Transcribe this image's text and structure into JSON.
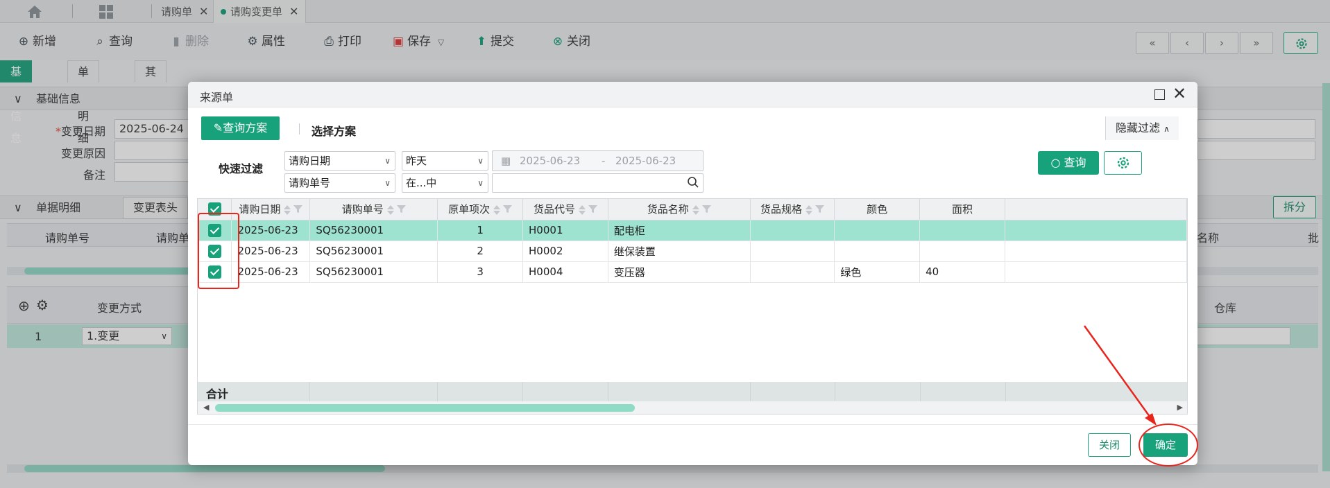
{
  "tabs": [
    {
      "label": "请购单"
    },
    {
      "label": "请购变更单"
    }
  ],
  "toolbar": {
    "add": "新增",
    "query": "查询",
    "delete": "删除",
    "attributes": "属性",
    "print": "打印",
    "save": "保存",
    "submit": "提交",
    "close": "关闭"
  },
  "subtabs": [
    "基础信息",
    "单据明细",
    "其他"
  ],
  "basic_section": {
    "title": "基础信息",
    "change_date_label": "变更日期",
    "change_date_value": "2025-06-24",
    "change_reason_label": "变更原因",
    "remark_label": "备注"
  },
  "detail_section": {
    "title": "单据明细",
    "change_header_btn": "变更表头",
    "split_btn": "拆分",
    "col_request_no": "请购单号",
    "col_request_short": "请购单",
    "col_name_partial": "名称",
    "col_batch_partial": "批"
  },
  "bottom_grid": {
    "col_change_method": "变更方式",
    "col_warehouse": "仓库",
    "row_num": "1",
    "row_method": "1.变更"
  },
  "dialog": {
    "title": "来源单",
    "scheme_btn": "查询方案",
    "select_scheme": "选择方案",
    "hide_filter": "隐藏过滤",
    "quick_filter": "快速过滤",
    "filter1_field": "请购日期",
    "filter1_op": "昨天",
    "date_from": "2025-06-23",
    "date_sep": "-",
    "date_to": "2025-06-23",
    "filter2_field": "请购单号",
    "filter2_op": "在...中",
    "query_btn": "查询",
    "columns": [
      "请购日期",
      "请购单号",
      "原单项次",
      "货品代号",
      "货品名称",
      "货品规格",
      "颜色",
      "面积"
    ],
    "rows": [
      {
        "date": "2025-06-23",
        "no": "SQ56230001",
        "line": "1",
        "code": "H0001",
        "name": "配电柜",
        "spec": "",
        "color": "",
        "area": ""
      },
      {
        "date": "2025-06-23",
        "no": "SQ56230001",
        "line": "2",
        "code": "H0002",
        "name": "继保装置",
        "spec": "",
        "color": "",
        "area": ""
      },
      {
        "date": "2025-06-23",
        "no": "SQ56230001",
        "line": "3",
        "code": "H0004",
        "name": "变压器",
        "spec": "",
        "color": "绿色",
        "area": "40"
      }
    ],
    "total_label": "合计",
    "close_btn": "关闭",
    "ok_btn": "确定"
  },
  "colors": {
    "accent": "#18a27c",
    "selected_row": "#9de3d0",
    "annotation": "#e8241d"
  }
}
